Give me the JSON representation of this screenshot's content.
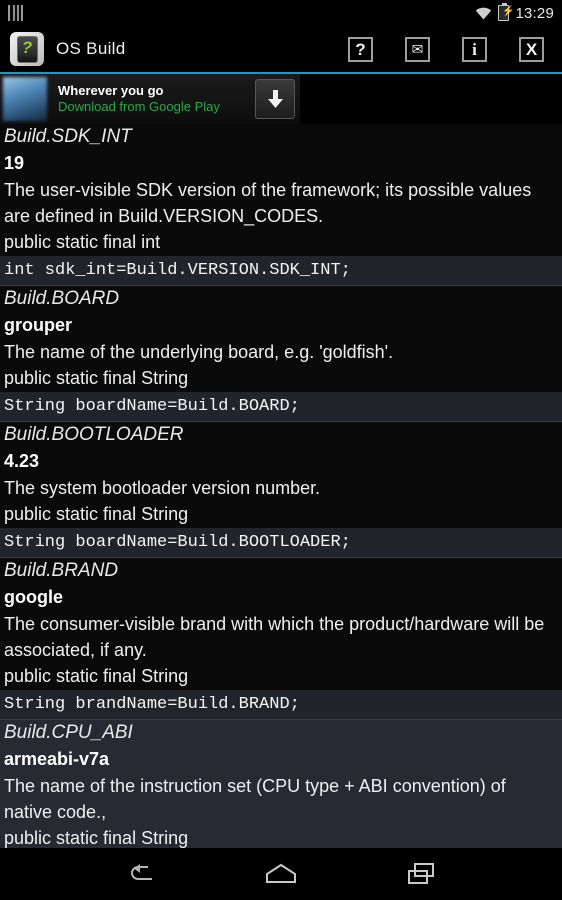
{
  "status_bar": {
    "sim_icon": "sim-card-icon",
    "wifi_icon": "wifi-icon",
    "battery_icon": "battery-charging-icon",
    "time": "13:29"
  },
  "action_bar": {
    "app_icon": "os-build-app-icon",
    "app_icon_glyph": "?",
    "title": "OS Build",
    "actions": [
      {
        "name": "help-button",
        "label": "?"
      },
      {
        "name": "mail-button",
        "label": "✉"
      },
      {
        "name": "info-button",
        "label": "i"
      },
      {
        "name": "close-button",
        "label": "X"
      }
    ]
  },
  "ad": {
    "thumbnail": "ad-thumbnail-image",
    "title": "Wherever you go",
    "subtitle": "Download from Google Play",
    "download_icon": "download-arrow-icon"
  },
  "colors": {
    "accent_rule": "#2196c4",
    "ad_link_green": "#2aa84a",
    "code_background": "#20242b",
    "highlight_background": "#262b33",
    "app_icon_green": "#9bc83a"
  },
  "entries": [
    {
      "name": "Build.SDK_INT",
      "value": "19",
      "description": "The user-visible SDK version of the framework; its possible values are defined in Build.VERSION_CODES.",
      "signature": "public static final int",
      "code": "int sdk_int=Build.VERSION.SDK_INT;",
      "highlighted": false
    },
    {
      "name": "Build.BOARD",
      "value": "grouper",
      "description": "The name of the underlying board, e.g. 'goldfish'.",
      "signature": "public static final String",
      "code": "String boardName=Build.BOARD;",
      "highlighted": false
    },
    {
      "name": "Build.BOOTLOADER",
      "value": "4.23",
      "description": "The system bootloader version number.",
      "signature": "public static final String",
      "code": "String boardName=Build.BOOTLOADER;",
      "highlighted": false
    },
    {
      "name": "Build.BRAND",
      "value": "google",
      "description": "The consumer-visible brand with which the product/hardware will be associated, if any.",
      "signature": "public static final String",
      "code": "String brandName=Build.BRAND;",
      "highlighted": false
    },
    {
      "name": "Build.CPU_ABI",
      "value": "armeabi-v7a",
      "description": "The name of the instruction set (CPU type + ABI convention) of native code.,",
      "signature": "public static final String",
      "code": "",
      "highlighted": true
    }
  ],
  "nav_bar": {
    "back": "back-icon",
    "home": "home-icon",
    "recents": "recents-icon"
  }
}
